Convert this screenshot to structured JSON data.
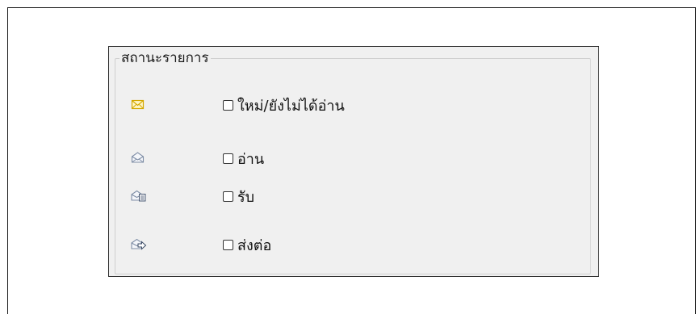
{
  "group": {
    "legend": "สถานะรายการ",
    "items": [
      {
        "icon": "new-unread-mail-icon",
        "label": "ใหม่/ยังไม่ได้อ่าน",
        "checked": false
      },
      {
        "icon": "read-mail-icon",
        "label": "อ่าน",
        "checked": false
      },
      {
        "icon": "received-mail-icon",
        "label": "รับ",
        "checked": false
      },
      {
        "icon": "forwarded-mail-icon",
        "label": "ส่งต่อ",
        "checked": false
      }
    ]
  },
  "colors": {
    "unread_envelope": "#e8c000",
    "read_envelope": "#8a9ab0",
    "panel_background": "#f0f0f0"
  }
}
